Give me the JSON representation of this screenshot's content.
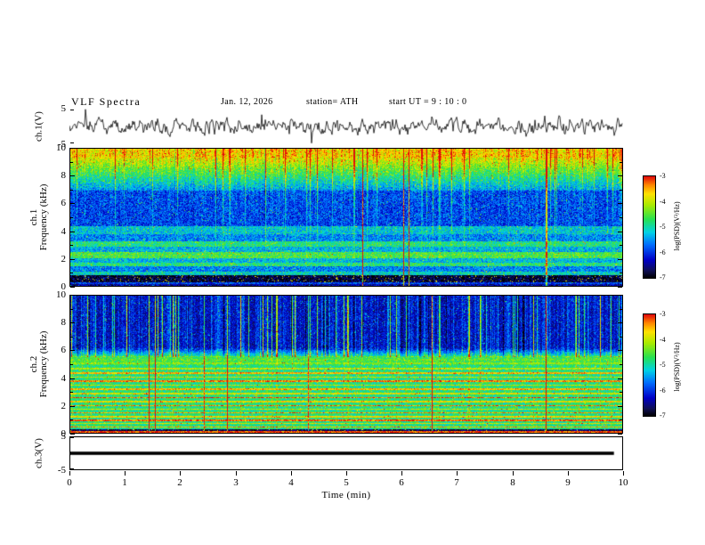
{
  "header": {
    "title": "VLF Spectra",
    "date": "Jan. 12, 2026",
    "station": "station= ATH",
    "start_ut": "start UT =  9 : 10 : 0"
  },
  "xaxis": {
    "label": "Time (min)",
    "range": [
      0,
      10
    ],
    "ticks": [
      0,
      1,
      2,
      3,
      4,
      5,
      6,
      7,
      8,
      9,
      10
    ]
  },
  "colors": {
    "background": "#ffffff",
    "frame": "#000000"
  },
  "chart_data": [
    {
      "id": "ch1_wave",
      "type": "line",
      "ylabel": "ch.1(V)",
      "ylim": [
        -5,
        5
      ],
      "yticks": [
        5,
        -5
      ],
      "xlim": [
        0,
        10
      ],
      "description": "Broadband noisy ch.1 voltage trace centered on 0 V with frequent impulsive spikes of 2-4 V"
    },
    {
      "id": "ch1_spec",
      "type": "heatmap",
      "ylabel_line1": "ch.1",
      "ylabel_line2": "Frequency (kHz)",
      "ylim": [
        0,
        10
      ],
      "yticks": [
        0,
        2,
        4,
        6,
        8,
        10
      ],
      "xlim": [
        0,
        10
      ],
      "colorbar": {
        "label": "log(PSD)(V²/Hz)",
        "ticks": [
          -3,
          -4,
          -5,
          -6,
          -7
        ],
        "range": [
          -7,
          -3
        ]
      },
      "description": "Spectrogram of ch.1: intense red/orange band above ~9 kHz fading to yellow-green, dense vertical impulsive streaks, blue background 4-7 kHz, bright cyan-green horizontal bands near 1.5-3.3 kHz, near-black band 0.3-0.8 kHz with red flecks",
      "texture": {
        "segments": [
          [
            0,
            0.15,
            -6.4,
            -6.4
          ],
          [
            0.15,
            0.3,
            -5.9,
            -5.9
          ],
          [
            0.3,
            0.8,
            -6.85,
            -6.85
          ],
          [
            0.8,
            1.1,
            -5.1,
            -5.1
          ],
          [
            1.1,
            1.45,
            -5.6,
            -5.6
          ],
          [
            1.45,
            1.7,
            -4.8,
            -4.8
          ],
          [
            1.7,
            2.05,
            -5.3,
            -5.3
          ],
          [
            2.05,
            2.5,
            -4.6,
            -4.6
          ],
          [
            2.5,
            2.9,
            -5.35,
            -5.35
          ],
          [
            2.9,
            3.25,
            -4.85,
            -4.85
          ],
          [
            3.25,
            3.8,
            -5.6,
            -5.6
          ],
          [
            3.8,
            4.4,
            -5.25,
            -5.25
          ],
          [
            4.4,
            7,
            -5.95,
            -5.95
          ],
          [
            7,
            9.4,
            -5.6,
            -3.95
          ],
          [
            9.4,
            10.01,
            -3.85,
            -3.85
          ]
        ],
        "lines": [],
        "streaks": {
          "prob": 0.06,
          "full_prob": 0.006,
          "weight": {
            "mode": "pow",
            "p": 1.6
          }
        },
        "noise": 0.5,
        "warm": {
          "f0": 0.3,
          "f1": 0.8,
          "prob": 0.05,
          "v": -3.8
        }
      }
    },
    {
      "id": "ch2_spec",
      "type": "heatmap",
      "ylabel_line1": "ch.2",
      "ylabel_line2": "Frequency (kHz)",
      "ylim": [
        0,
        10
      ],
      "yticks": [
        0,
        2,
        4,
        6,
        8,
        10
      ],
      "xlim": [
        0,
        10
      ],
      "colorbar": {
        "label": "log(PSD)(V²/Hz)",
        "ticks": [
          -3,
          -4,
          -5,
          -6,
          -7
        ],
        "range": [
          -7,
          -3
        ]
      },
      "description": "Spectrogram of ch.2: dark blue/black above ~6 kHz with cyan-green vertical striations, green background below 5 kHz crossed by many yellow/orange/red horizontal harmonic lines, dark band near 0.2-0.3 kHz and a red line at the very bottom",
      "texture": {
        "segments": [
          [
            0,
            0.15,
            -4.6,
            -4.6
          ],
          [
            0.15,
            0.32,
            -6.75,
            -6.75
          ],
          [
            0.32,
            5,
            -4.85,
            -4.85
          ],
          [
            5,
            5.6,
            -4.65,
            -4.65
          ],
          [
            5.6,
            6.2,
            -5,
            -6.3
          ],
          [
            6.2,
            10.01,
            -6.35,
            -6.35
          ]
        ],
        "lines": [
          [
            0.08,
            -3.2,
            0.07
          ],
          [
            0.45,
            -3.6
          ],
          [
            0.7,
            -3.9
          ],
          [
            0.95,
            -3.3
          ],
          [
            1.2,
            -3.8
          ],
          [
            1.5,
            -3.5
          ],
          [
            1.75,
            -4
          ],
          [
            2,
            -3.4
          ],
          [
            2.3,
            -3.8
          ],
          [
            2.6,
            -3.3
          ],
          [
            2.9,
            -3.9
          ],
          [
            3.2,
            -3.6
          ],
          [
            3.5,
            -4
          ],
          [
            3.8,
            -3.4
          ],
          [
            4.1,
            -3.9
          ],
          [
            4.4,
            -3.6
          ],
          [
            4.7,
            -4.1
          ],
          [
            5.1,
            -4.3
          ],
          [
            5.35,
            -4.5
          ]
        ],
        "streaks": {
          "prob": 0.07,
          "full_prob": 0.009,
          "weight": {
            "mode": "step",
            "f": 5.55,
            "hi": 1,
            "lo": 0.13
          }
        },
        "noise": 0.42,
        "warm": {
          "f0": 0.15,
          "f1": 0.32,
          "prob": 0.03,
          "v": -3.8
        }
      }
    },
    {
      "id": "ch3_wave",
      "type": "line",
      "ylabel": "ch.3(V)",
      "ylim": [
        -5,
        5
      ],
      "yticks": [
        5,
        -5
      ],
      "xlim": [
        0,
        10
      ],
      "description": "Flat ch.3 trace pinned at 0 V drawn as a thick black line (no signal)"
    }
  ]
}
